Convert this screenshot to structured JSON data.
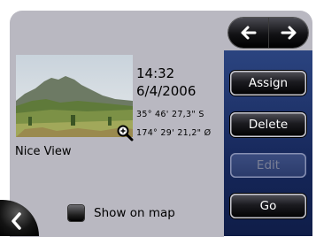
{
  "waypoint": {
    "time": "14:32",
    "date": "6/4/2006",
    "latitude": "35° 46' 27,3\" S",
    "longitude": "174° 29' 21,2\" Ø",
    "name": "Nice View"
  },
  "buttons": {
    "assign": "Assign",
    "delete": "Delete",
    "edit": "Edit",
    "go": "Go"
  },
  "options": {
    "show_on_map_label": "Show on map",
    "show_on_map_checked": false
  },
  "colors": {
    "pane_bg": "#b9b8c1",
    "sidebar_blue": "#16275a",
    "button_black": "#000000"
  }
}
